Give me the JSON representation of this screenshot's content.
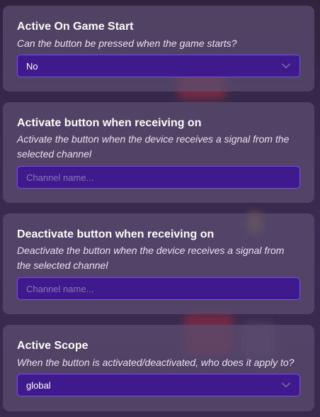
{
  "sections": [
    {
      "title": "Active On Game Start",
      "description": "Can the button be pressed when the game starts?",
      "control": {
        "type": "select",
        "value": "No",
        "icon": "chevron-down-icon"
      }
    },
    {
      "title": "Activate button when receiving on",
      "description": "Activate the button when the device receives a signal from the selected channel",
      "control": {
        "type": "text",
        "value": "",
        "placeholder": "Channel name..."
      }
    },
    {
      "title": "Deactivate button when receiving on",
      "description": "Deactivate the button when the device receives a signal from the selected channel",
      "control": {
        "type": "text",
        "value": "",
        "placeholder": "Channel name..."
      }
    },
    {
      "title": "Active Scope",
      "description": "When the button is activated/deactivated, who does it apply to?",
      "control": {
        "type": "select",
        "value": "global",
        "icon": "chevron-down-icon"
      }
    }
  ],
  "colors": {
    "card": "#5c4e70",
    "field": "#3f1a8c",
    "field_border": "#7a4bf0",
    "title": "#ffffff"
  }
}
